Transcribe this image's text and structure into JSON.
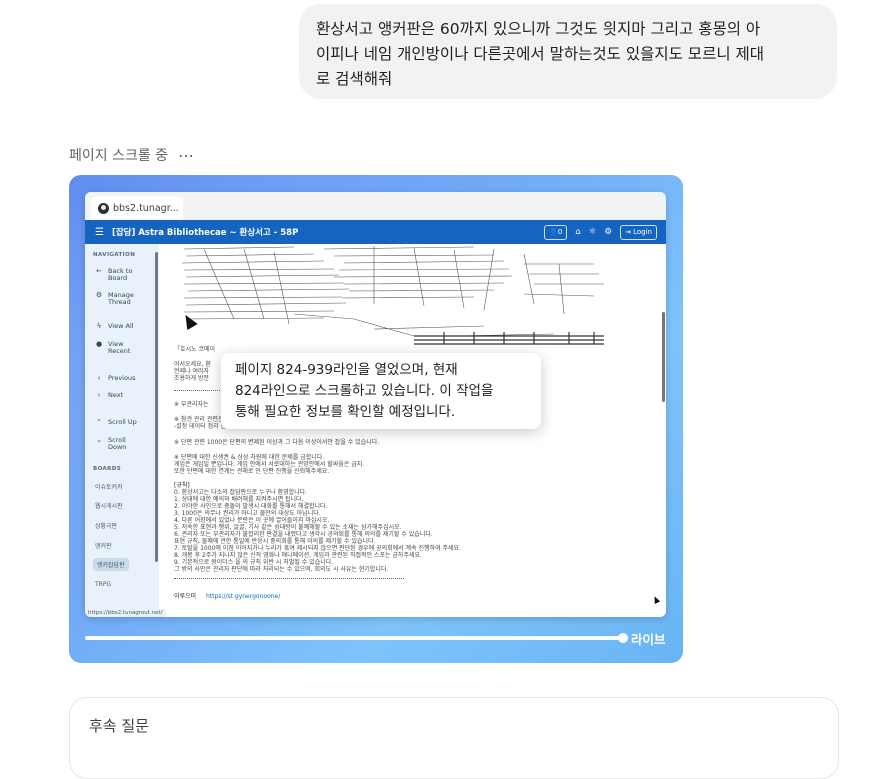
{
  "user_message": {
    "lines": [
      "환상서고 앵커판은 60까지 있으니까 그것도 읫지마 그리고 홍몽의 아",
      "이피나 네임 개인방이나 다른곳에서 말하는것도 있을지도 모르니 제대",
      "로 검색해줘"
    ]
  },
  "status": {
    "label": "페이지 스크롤 중",
    "more": "⋯"
  },
  "browser": {
    "tab_title": "bbs2.tunagr...",
    "app_title": "[잡담] Astra Bibliothecae ~ 환상서고 - 58P",
    "user_count": "0",
    "login_label": "Login",
    "status_url": "https://bbs2.tunagrout.net/"
  },
  "sidebar": {
    "nav_heading": "NAVIGATION",
    "items": [
      {
        "icon": "←",
        "label": "Back to\nBoard"
      },
      {
        "icon": "⚙",
        "label": "Manage\nThread"
      },
      {
        "icon": "ϟ",
        "label": "View All"
      },
      {
        "icon": "●",
        "label": "View\nRecent"
      },
      {
        "icon": "‹",
        "label": "Previous"
      },
      {
        "icon": "›",
        "label": "Next"
      },
      {
        "icon": "⌃",
        "label": "Scroll Up"
      },
      {
        "icon": "⌄",
        "label": "Scroll\nDown"
      }
    ],
    "boards_heading": "BOARDS",
    "boards": [
      "이슈토커커",
      "웹시게시판",
      "상황극판",
      "앵커판",
      "앵커잡담판",
      "TRPG"
    ],
    "active_board": "앵커잡담판"
  },
  "content": {
    "lines": [
      "「호시노 코메이",
      "어서오세요, 환",
      "언제나 여러자",
      "조용하게 방문",
      "※ 부관리자는",
      "※ 참견 관리 관련은 관련이 관련 이제 관련합니다.",
      "-설정 데이터 정리 진행 이동...?",
      "※ 단편 관련 1000은 단편의 변제된 이상과 그 다음 이상이서만 잡을 수 있습니다.",
      "※ 단편에 대한 신생권 & 상상 차원에 대한 문제를 금합니다.",
      "게임은 게임일 뿐입니다. 게임 안에서 서로대하는 관망안에서 할싸움은 금지.",
      "또한 단편에 대한 연계는 관래로 인 단편 진행을 신뢰해주세요.",
      "[규칙]",
      "0. 환상서고는 다소의 잡담판으로 누구나 환영합니다.",
      "1. 상대에 대한 예의와 배려해를 지켜주시면 됩니다.",
      "2. 이야한 사인으로 충돌이 발생시 대화를 통해서 해결합니다.",
      "3. 1000은 의무나 권리가 아니고 불만의 대상도 아닙니다.",
      "4. 다른 어장에서 있었나 분란은 이 곳에 끌어들이지 마십시오.",
      "5. 저속한 표현과 행위, 얼굴, 기사 같은 성대방이 불쾌해할 수 있는 소재는 삼가해주십시오.",
      "6. 관리자 또는 부관리자가 불합리한 판결을 내렸다고 생각시 공의회를 통해 의의를 제기할 수 있습니다.",
      "표현 규칙, 불쾌에 관한 통일에 반응시 중의회를 통해 이의를 제기할 수 있습니다.",
      "7. 토탈을 1000에 이점 이어지거나 누리가 혹여 제시되지 않으면 판단된 경우에 공의회에서 계속 진행하여 주세요.",
      "8. 개봉 후 2주가 지나지 않은 신작 영화나 애니메이션, 게임과 관련된 직접적인 스포는 금하주세요.",
      "9. 기본적으로 왕이더스     을 의 규칙 위반 시 처벌될 수 있습니다.",
      "그 밖의 사안은 관리자 판단에 따라 처리되는 수 있으며, 회의도 시 사유는 현기합니다.",
      "이루으미",
      "https://st.gynergonoone/"
    ]
  },
  "callout": {
    "lines": [
      "페이지 824-939라인을 열었으며, 현재",
      "824라인으로 스크롤하고 있습니다. 이 작업을",
      "통해 필요한 정보를 확인할 예정입니다."
    ]
  },
  "player": {
    "progress": 0.98,
    "live_label": "라이브"
  },
  "followup": {
    "label": "후속 질문"
  }
}
